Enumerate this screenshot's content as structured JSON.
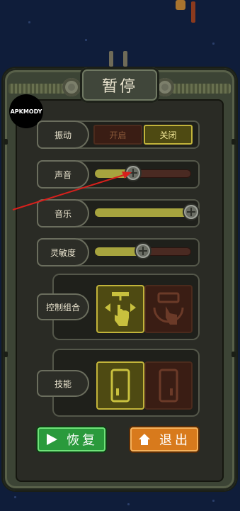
{
  "title": "暂停",
  "watermark": "APKMODY",
  "vibration": {
    "label": "振动",
    "on_label": "开启",
    "off_label": "关闭",
    "selected": "off"
  },
  "sound": {
    "label": "声音",
    "level_percent": 40
  },
  "music": {
    "label": "音乐",
    "level_percent": 100
  },
  "sensitivity": {
    "label": "灵敏度",
    "level_percent": 50
  },
  "control_combo": {
    "label": "控制组合",
    "options": [
      "touch-drag-icon",
      "tilt-control-icon"
    ],
    "selected_index": 0
  },
  "skill": {
    "label": "技能",
    "options": [
      "phone-portrait-icon",
      "phone-alt-icon"
    ],
    "selected_index": 0
  },
  "buttons": {
    "resume": "恢复",
    "exit": "退出"
  },
  "colors": {
    "accent_on": "#c2b43a",
    "resume": "#2a9a3c",
    "exit": "#d87a1c",
    "arrow": "#d8201c"
  }
}
